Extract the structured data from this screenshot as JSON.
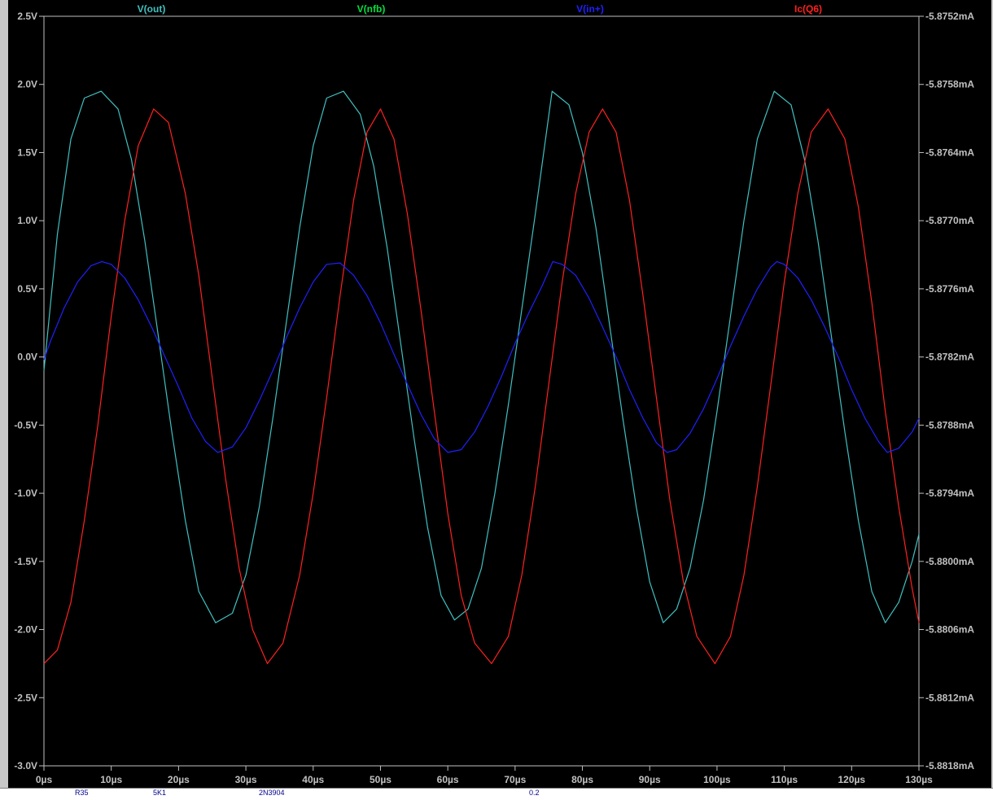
{
  "colors": {
    "background": "#000000",
    "axis": "#c0c0c0",
    "v_out": "#40c0c0",
    "v_nfb": "#00e040",
    "v_in": "#2020ff",
    "ic_q6": "#ff2020"
  },
  "chart_data": {
    "type": "line",
    "title": "",
    "xlabel": "",
    "ylabel": "",
    "legend": [
      "V(out)",
      "V(nfb)",
      "V(in+)",
      "Ic(Q6)"
    ],
    "x_ticks": [
      "0µs",
      "10µs",
      "20µs",
      "30µs",
      "40µs",
      "50µs",
      "60µs",
      "70µs",
      "80µs",
      "90µs",
      "100µs",
      "110µs",
      "120µs",
      "130µs"
    ],
    "y_left_ticks": [
      "2.5V",
      "2.0V",
      "1.5V",
      "1.0V",
      "0.5V",
      "0.0V",
      "-0.5V",
      "-1.0V",
      "-1.5V",
      "-2.0V",
      "-2.5V",
      "-3.0V"
    ],
    "y_right_ticks": [
      "-5.8752mA",
      "-5.8758mA",
      "-5.8764mA",
      "-5.8770mA",
      "-5.8776mA",
      "-5.8782mA",
      "-5.8788mA",
      "-5.8794mA",
      "-5.8800mA",
      "-5.8806mA",
      "-5.8812mA",
      "-5.8818mA"
    ],
    "xlim": [
      0,
      130
    ],
    "ylim_left": [
      -3.0,
      2.5
    ],
    "ylim_right": [
      -5.8818,
      -5.8752
    ],
    "grid": false,
    "series": [
      {
        "name": "V(out)",
        "axis": "left",
        "color": "#40c0c0",
        "x": [
          0,
          2,
          4,
          6,
          8.5,
          11,
          13,
          15,
          17,
          19,
          21,
          23,
          25.5,
          28,
          30,
          32,
          34,
          36,
          38,
          40,
          42,
          44.5,
          47,
          49,
          51,
          53,
          55,
          57,
          59,
          61,
          63,
          65,
          67,
          69,
          71,
          73,
          75.5,
          78,
          80,
          82,
          84,
          86,
          88,
          90,
          92,
          94,
          96,
          98,
          100,
          102,
          104,
          106,
          108.5,
          111,
          113,
          115,
          117,
          119,
          121,
          123,
          125,
          127,
          129,
          130
        ],
        "y": [
          -0.1,
          0.9,
          1.6,
          1.9,
          1.95,
          1.82,
          1.45,
          0.85,
          0.15,
          -0.55,
          -1.2,
          -1.72,
          -1.95,
          -1.88,
          -1.6,
          -1.1,
          -0.45,
          0.25,
          0.95,
          1.55,
          1.9,
          1.95,
          1.78,
          1.4,
          0.8,
          0.1,
          -0.6,
          -1.25,
          -1.75,
          -1.93,
          -1.85,
          -1.55,
          -1.0,
          -0.35,
          0.35,
          1.05,
          1.95,
          1.85,
          1.5,
          0.95,
          0.25,
          -0.45,
          -1.1,
          -1.65,
          -1.95,
          -1.85,
          -1.55,
          -1.05,
          -0.4,
          0.3,
          1.0,
          1.6,
          1.95,
          1.85,
          1.45,
          0.85,
          0.15,
          -0.55,
          -1.2,
          -1.72,
          -1.95,
          -1.8,
          -1.5,
          -1.3
        ]
      },
      {
        "name": "Ic(Q6)",
        "axis": "left",
        "color": "#ff2020",
        "x": [
          0,
          2,
          4,
          6,
          8,
          10,
          12,
          14,
          16.3,
          18.5,
          21,
          23,
          25,
          27,
          29,
          31,
          33.2,
          35.5,
          38,
          40,
          42,
          44,
          46,
          48,
          50,
          52,
          54,
          56,
          58,
          60,
          62,
          64,
          66.5,
          69,
          71,
          73,
          75,
          77,
          79,
          81,
          83,
          85,
          87,
          89,
          91,
          93,
          95,
          97,
          99.7,
          102,
          104,
          106,
          108,
          110,
          112,
          114,
          116.5,
          119,
          121,
          123,
          125,
          127,
          129,
          130
        ],
        "y": [
          -2.25,
          -2.15,
          -1.8,
          -1.2,
          -0.5,
          0.3,
          1.0,
          1.55,
          1.82,
          1.72,
          1.2,
          0.6,
          -0.15,
          -0.9,
          -1.55,
          -2.0,
          -2.25,
          -2.1,
          -1.6,
          -1.0,
          -0.3,
          0.45,
          1.15,
          1.65,
          1.82,
          1.6,
          1.05,
          0.35,
          -0.4,
          -1.15,
          -1.75,
          -2.1,
          -2.25,
          -2.05,
          -1.6,
          -0.95,
          -0.2,
          0.55,
          1.2,
          1.65,
          1.82,
          1.65,
          1.15,
          0.45,
          -0.3,
          -1.05,
          -1.65,
          -2.05,
          -2.25,
          -2.05,
          -1.6,
          -0.95,
          -0.2,
          0.55,
          1.2,
          1.65,
          1.82,
          1.6,
          1.1,
          0.4,
          -0.4,
          -1.1,
          -1.7,
          -1.95
        ]
      },
      {
        "name": "V(in+)",
        "axis": "left",
        "color": "#2020ff",
        "x": [
          0,
          1,
          3,
          5,
          7,
          8.6,
          10,
          12,
          14,
          16,
          18,
          20,
          22,
          24,
          25.8,
          28,
          30,
          32,
          34,
          36,
          38,
          40,
          42,
          44,
          46,
          48,
          50,
          52,
          54,
          56,
          58,
          60,
          62,
          64,
          66,
          68,
          70,
          72,
          74,
          75.6,
          77,
          79,
          81,
          83,
          85,
          87,
          89,
          91,
          92.6,
          94,
          96,
          98,
          100,
          102,
          104,
          106,
          108,
          108.9,
          110,
          112,
          114,
          116,
          118,
          120,
          122,
          124,
          125.3,
          127,
          129,
          130
        ],
        "y": [
          -0.02,
          0.12,
          0.36,
          0.55,
          0.67,
          0.7,
          0.68,
          0.58,
          0.42,
          0.22,
          0.0,
          -0.22,
          -0.45,
          -0.62,
          -0.7,
          -0.66,
          -0.52,
          -0.32,
          -0.1,
          0.14,
          0.36,
          0.55,
          0.68,
          0.69,
          0.6,
          0.45,
          0.25,
          0.02,
          -0.2,
          -0.42,
          -0.6,
          -0.7,
          -0.68,
          -0.55,
          -0.36,
          -0.14,
          0.1,
          0.32,
          0.52,
          0.7,
          0.68,
          0.6,
          0.43,
          0.22,
          0.0,
          -0.24,
          -0.45,
          -0.63,
          -0.7,
          -0.68,
          -0.56,
          -0.38,
          -0.16,
          0.08,
          0.3,
          0.5,
          0.66,
          0.7,
          0.68,
          0.58,
          0.42,
          0.22,
          0.0,
          -0.24,
          -0.45,
          -0.62,
          -0.7,
          -0.67,
          -0.55,
          -0.45
        ]
      }
    ]
  },
  "bottom_strip": {
    "items": [
      "R35",
      "5K1",
      "2N3904",
      "0.2"
    ]
  }
}
